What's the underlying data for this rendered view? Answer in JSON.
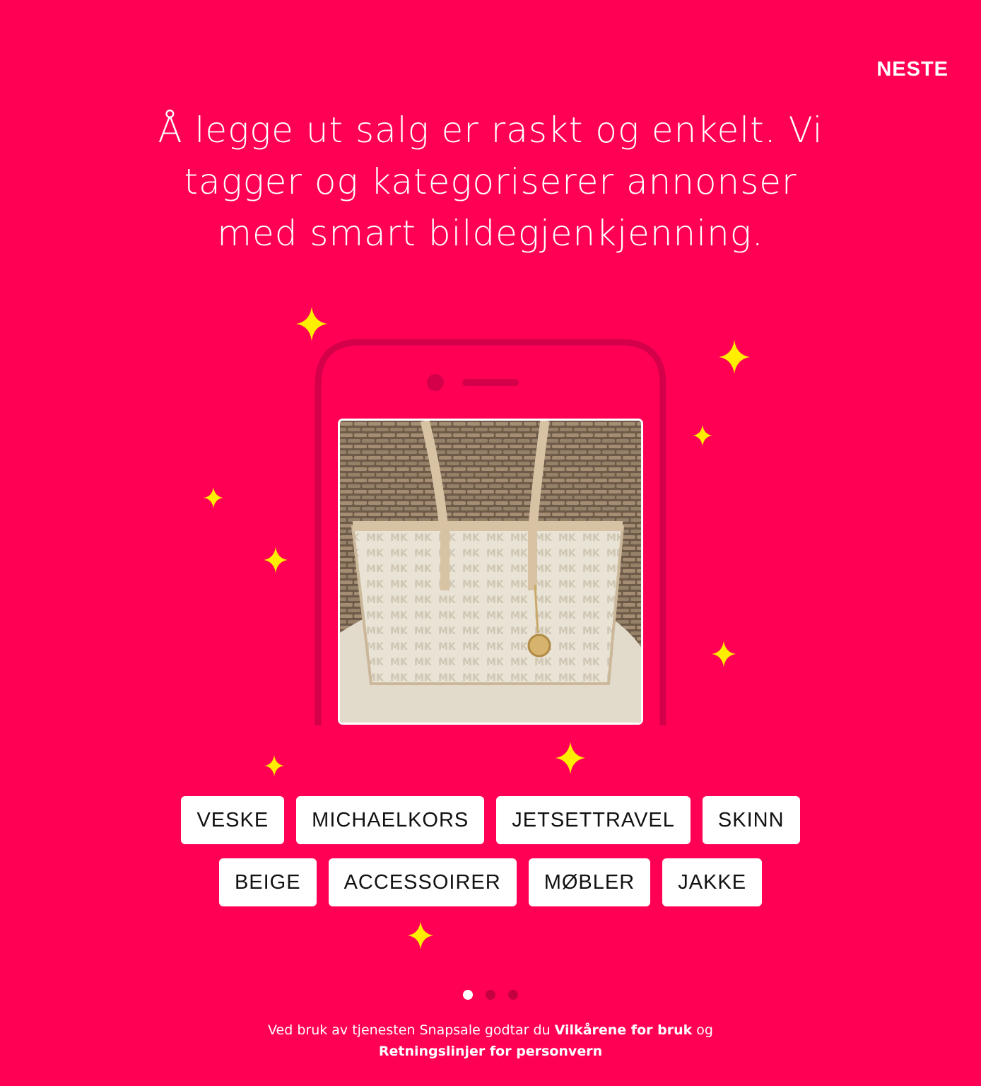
{
  "header": {
    "next_label": "NESTE"
  },
  "intro": {
    "headline": "Å legge ut salg er raskt og enkelt. Vi tagger og kategoriserer annonser med smart bildegjenkjenning."
  },
  "tags": {
    "row1": [
      "VESKE",
      "MICHAELKORS",
      "JETSETTRAVEL",
      "SKINN"
    ],
    "row2": [
      "BEIGE",
      "ACCESSOIRER",
      "MØBLER",
      "JAKKE"
    ]
  },
  "pager": {
    "total_pages": 3,
    "current_page": 1
  },
  "footer": {
    "text_before": "Ved bruk av tjenesten Snapsale godtar du ",
    "terms_link": "Vilkårene for bruk",
    "text_between": " og ",
    "privacy_link": "Retningslinjer for personvern"
  },
  "colors": {
    "background": "#FF0055",
    "phone_outline": "#D4004A",
    "sparkle": "#FFEE00",
    "tag_background": "#FFFFFF",
    "dot_inactive": "#C40040",
    "dot_active": "#FFFFFF"
  },
  "icons": {
    "sparkle": "sparkle-icon",
    "phone": "phone-outline-icon"
  }
}
